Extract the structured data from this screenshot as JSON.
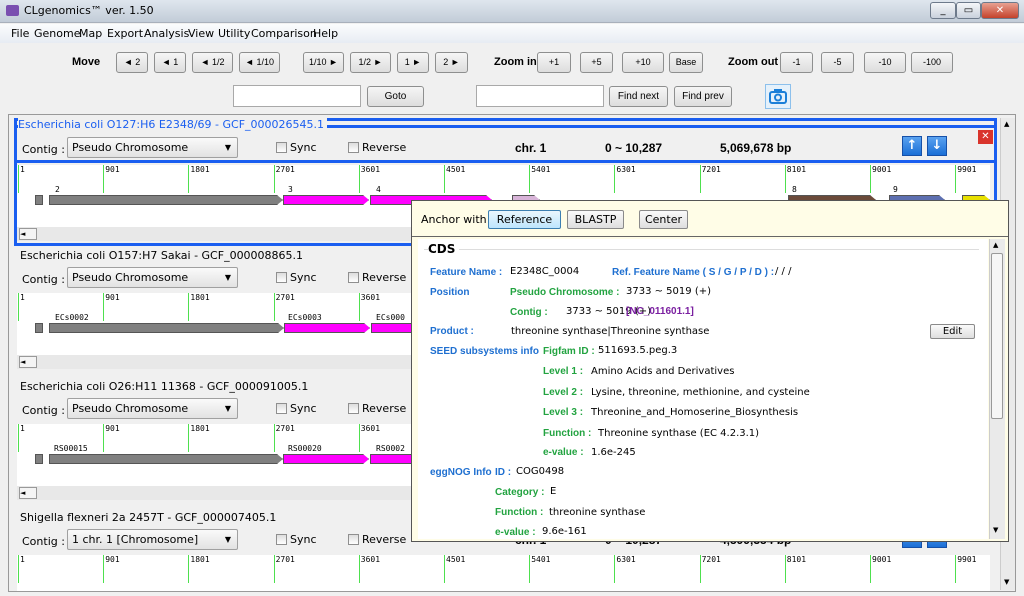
{
  "window": {
    "title": "CLgenomics™ ver. 1.50",
    "controls": [
      "_",
      "▭",
      "✕"
    ]
  },
  "menu": [
    "File",
    "Genome",
    "Map",
    "Export",
    "Analysis",
    "View",
    "Utility",
    "Comparison",
    "Help"
  ],
  "toolbar": {
    "move_label": "Move",
    "move_buttons": [
      "◄ 2",
      "◄ 1",
      "◄ 1/2",
      "◄ 1/10",
      "1/10 ►",
      "1/2 ►",
      "1 ►",
      "2 ►"
    ],
    "zoom_in_label": "Zoom in",
    "zoom_in_buttons": [
      "+1",
      "+5",
      "+10",
      "Base"
    ],
    "zoom_out_label": "Zoom out",
    "zoom_out_buttons": [
      "-1",
      "-5",
      "-10",
      "-100"
    ],
    "goto_value": "",
    "goto_label": "Goto",
    "find_value": "",
    "find_next": "Find next",
    "find_prev": "Find prev",
    "camera_icon": "camera-icon"
  },
  "ruler_ticks": [
    "1",
    "901",
    "1801",
    "2701",
    "3601",
    "4501",
    "5401",
    "6301",
    "7201",
    "8101",
    "9001",
    "9901"
  ],
  "panels": [
    {
      "title": "Escherichia coli O127:H6 E2348/69 - GCF_000026545.1",
      "contig_label": "Contig :",
      "contig": "Pseudo Chromosome",
      "sync": "Sync",
      "reverse": "Reverse",
      "chr": "chr. 1",
      "range": "0 ~ 10,287",
      "size": "5,069,678 bp",
      "genes": [
        "2",
        "3",
        "4",
        "8",
        "9"
      ]
    },
    {
      "title": "Escherichia coli O157:H7 Sakai - GCF_000008865.1",
      "contig_label": "Contig :",
      "contig": "Pseudo Chromosome",
      "sync": "Sync",
      "reverse": "Reverse",
      "genes": [
        "ECs0002",
        "ECs0003",
        "ECs000"
      ]
    },
    {
      "title": "Escherichia coli O26:H11 11368 - GCF_000091005.1",
      "contig_label": "Contig :",
      "contig": "Pseudo Chromosome",
      "sync": "Sync",
      "reverse": "Reverse",
      "genes": [
        "RS00015",
        "RS00020",
        "RS0002"
      ]
    },
    {
      "title": "Shigella flexneri 2a 2457T - GCF_000007405.1",
      "contig_label": "Contig :",
      "contig": "1 chr. 1 [Chromosome]",
      "sync": "Sync",
      "reverse": "Reverse",
      "chr": "chr. 1",
      "range": "0 ~ 10,287",
      "size": "4,599,354 bp"
    }
  ],
  "popup": {
    "anchor_label": "Anchor with",
    "buttons": [
      "Reference",
      "BLASTP",
      "Center"
    ],
    "section": "CDS",
    "feature_name_key": "Feature Name :",
    "feature_name": "E2348C_0004",
    "ref_feature_key": "Ref. Feature Name ( S / G / P / D ) :",
    "ref_feature": "/ / /",
    "position_key": "Position",
    "pseudo_key": "Pseudo Chromosome :",
    "pseudo_val": "3733 ~ 5019 (+)",
    "contig_key": "Contig  :",
    "contig_val": "3733 ~ 5019 (+)",
    "contig_acc": "[NC_011601.1]",
    "product_key": "Product :",
    "product": "threonine synthase|Threonine synthase",
    "edit": "Edit",
    "seed_key": "SEED subsystems info",
    "figfam_key": "Figfam ID :",
    "figfam": "511693.5.peg.3",
    "level1_key": "Level 1 :",
    "level1": "Amino Acids and Derivatives",
    "level2_key": "Level 2 :",
    "level2": "Lysine, threonine, methionine, and cysteine",
    "level3_key": "Level 3 :",
    "level3": "Threonine_and_Homoserine_Biosynthesis",
    "function_key": "Function :",
    "function": "Threonine synthase (EC 4.2.3.1)",
    "evalue_key": "e-value :",
    "evalue": "1.6e-245",
    "eggnog_key": "eggNOG Info",
    "id_key": "ID :",
    "id": "COG0498",
    "category_key": "Category :",
    "category": "E",
    "egg_function_key": "Function :",
    "egg_function": "threonine synthase",
    "egg_evalue_key": "e-value :",
    "egg_evalue": "9.6e-161"
  },
  "colors": {
    "selected_border": "#1a5ef0",
    "gene_gray": "#808080",
    "gene_magenta": "#ff00ff",
    "tick": "#4ee04e",
    "key_blue": "#1e6fd0",
    "key_green": "#22a340",
    "accession": "#7a1fa0"
  }
}
